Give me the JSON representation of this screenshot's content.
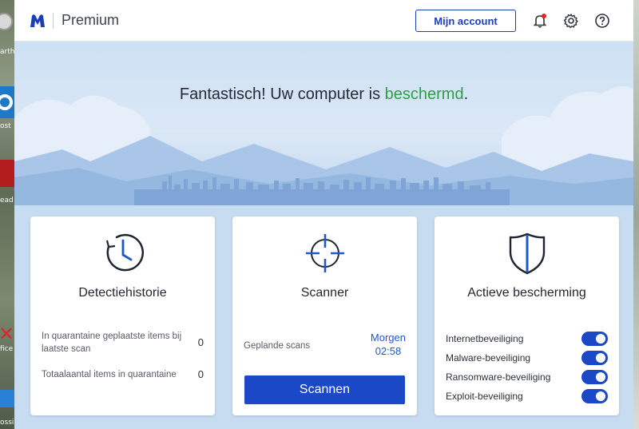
{
  "desktop": {
    "labels": [
      "arth",
      "ost",
      "ead",
      "fice",
      "ossi"
    ]
  },
  "titlebar": {
    "app_name": "Premium",
    "account_label": "Mijn account",
    "icons": [
      "notification-bell-icon",
      "settings-gear-icon",
      "help-icon"
    ]
  },
  "hero": {
    "status_prefix": "Fantastisch! Uw computer is ",
    "status_word": "beschermd",
    "status_suffix": ".",
    "status_color": "#2d9f46"
  },
  "cards": {
    "history": {
      "title": "Detectiehistorie",
      "icon": "clock-icon",
      "rows": [
        {
          "label": "In quarantaine geplaatste items bij laatste scan",
          "value": "0"
        },
        {
          "label": "Totaalaantal items in quarantaine",
          "value": "0"
        }
      ]
    },
    "scanner": {
      "title": "Scanner",
      "icon": "crosshair-icon",
      "scheduled_label": "Geplande scans",
      "scheduled_day": "Morgen",
      "scheduled_time": "02:58",
      "scan_button": "Scannen"
    },
    "protection": {
      "title": "Actieve bescherming",
      "icon": "shield-icon",
      "items": [
        {
          "label": "Internetbeveiliging",
          "enabled": true
        },
        {
          "label": "Malware-beveiliging",
          "enabled": true
        },
        {
          "label": "Ransomware-beveiliging",
          "enabled": true
        },
        {
          "label": "Exploit-beveiliging",
          "enabled": true
        }
      ]
    }
  },
  "colors": {
    "accent": "#1b48c6",
    "brand": "#1c3fb8",
    "protected": "#2d9f46"
  }
}
